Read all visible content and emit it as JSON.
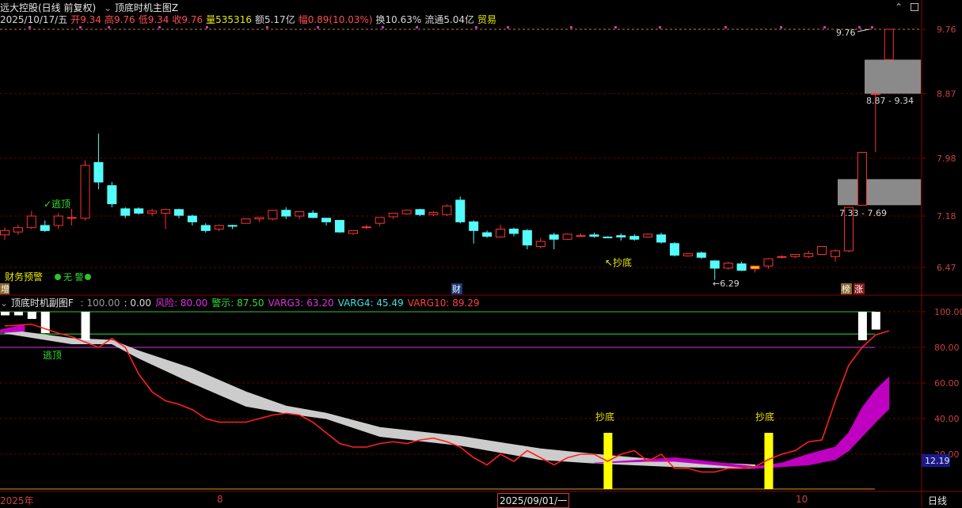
{
  "main_header": {
    "stock": "远大控股(日线 前复权)",
    "indicator": "顶底时机主图Z"
  },
  "info_bar": [
    {
      "text": "2025/10/17/五",
      "color": "#d8d8d8"
    },
    {
      "text": "开9.34",
      "color": "#ff4d4d"
    },
    {
      "text": "高9.76",
      "color": "#ff4d4d"
    },
    {
      "text": "低9.34",
      "color": "#ff4d4d"
    },
    {
      "text": "收9.76",
      "color": "#ff4d4d"
    },
    {
      "text": "量535316",
      "color": "#e8e800"
    },
    {
      "text": "额5.17亿",
      "color": "#d8d8d8"
    },
    {
      "text": "幅0.89(10.03%)",
      "color": "#ff4d4d"
    },
    {
      "text": "换10.63%",
      "color": "#d8d8d8"
    },
    {
      "text": "流通5.04亿",
      "color": "#d8d8d8"
    },
    {
      "text": "贸易",
      "color": "#e8e800"
    }
  ],
  "sub_header": {
    "name": "顶底时机副图F",
    "values": [
      {
        "text": ": 100.00",
        "color": "#9a9a9a"
      },
      {
        "text": ": 0.00",
        "color": "#d8d8d8"
      },
      {
        "text": "风险: 80.00",
        "color": "#e030e0"
      },
      {
        "text": "警示: 87.50",
        "color": "#30e030"
      },
      {
        "text": "VARG3: 63.20",
        "color": "#e030e0"
      },
      {
        "text": "VARG4: 45.49",
        "color": "#40e0e0"
      },
      {
        "text": "VARG10: 89.29",
        "color": "#ff4040"
      }
    ]
  },
  "labels": {
    "escape_top_main": "✓逃顶",
    "fin_warning": "财务预警",
    "fin_warning_none": "无 警",
    "bottom_buy_main": "↖抄底",
    "low_marker": "←6.29",
    "high_marker": "9.76",
    "zone_upper": "8.87 - 9.34",
    "zone_lower": "7.33 - 7.69",
    "badge_left": "增",
    "badge_cai": "财",
    "badge_bang": "榜",
    "badge_zhang": "涨",
    "escape_top_sub": "逃顶",
    "bottom_buy_sub_1": "抄底",
    "bottom_buy_sub_2": "抄底",
    "current_value_tag": "12.19"
  },
  "bottom_axis": {
    "labels": [
      "2025年",
      "8",
      "2025/09/01/一",
      "10"
    ],
    "period": "日线"
  },
  "colors": {
    "up": "#ff3232",
    "down": "#54fcfc",
    "grid": "#8b0000",
    "risk_line": "#e030e0",
    "warn_line": "#30e030",
    "varg3": "#c000c0",
    "varg4": "#cccccc",
    "varg10": "#ff2020",
    "bottom_bar": "#ffff00"
  },
  "chart_data": [
    {
      "type": "candlestick",
      "title": "远大控股(日线 前复权)",
      "y_ticks": [
        6.47,
        7.18,
        7.98,
        8.87,
        9.76
      ],
      "candles": [
        {
          "o": 6.92,
          "h": 7.02,
          "l": 6.85,
          "c": 6.98
        },
        {
          "o": 6.96,
          "h": 7.06,
          "l": 6.92,
          "c": 7.02
        },
        {
          "o": 7.02,
          "h": 7.25,
          "l": 7.0,
          "c": 7.18
        },
        {
          "o": 7.05,
          "h": 7.12,
          "l": 6.96,
          "c": 6.98
        },
        {
          "o": 7.05,
          "h": 7.22,
          "l": 7.0,
          "c": 7.18
        },
        {
          "o": 7.16,
          "h": 7.28,
          "l": 7.05,
          "c": 7.16
        },
        {
          "o": 7.15,
          "h": 7.95,
          "l": 7.12,
          "c": 7.88
        },
        {
          "o": 7.92,
          "h": 8.32,
          "l": 7.55,
          "c": 7.65
        },
        {
          "o": 7.6,
          "h": 7.65,
          "l": 7.3,
          "c": 7.35
        },
        {
          "o": 7.28,
          "h": 7.3,
          "l": 7.15,
          "c": 7.19
        },
        {
          "o": 7.28,
          "h": 7.3,
          "l": 7.2,
          "c": 7.22
        },
        {
          "o": 7.22,
          "h": 7.28,
          "l": 7.18,
          "c": 7.25
        },
        {
          "o": 7.22,
          "h": 7.28,
          "l": 7.0,
          "c": 7.27
        },
        {
          "o": 7.27,
          "h": 7.28,
          "l": 7.15,
          "c": 7.19
        },
        {
          "o": 7.18,
          "h": 7.2,
          "l": 7.05,
          "c": 7.1
        },
        {
          "o": 7.05,
          "h": 7.08,
          "l": 6.95,
          "c": 6.98
        },
        {
          "o": 7.0,
          "h": 7.06,
          "l": 6.97,
          "c": 7.05
        },
        {
          "o": 7.05,
          "h": 7.06,
          "l": 7.0,
          "c": 7.04
        },
        {
          "o": 7.08,
          "h": 7.14,
          "l": 7.08,
          "c": 7.14
        },
        {
          "o": 7.14,
          "h": 7.16,
          "l": 7.1,
          "c": 7.16
        },
        {
          "o": 7.14,
          "h": 7.26,
          "l": 7.12,
          "c": 7.26
        },
        {
          "o": 7.26,
          "h": 7.3,
          "l": 7.14,
          "c": 7.18
        },
        {
          "o": 7.18,
          "h": 7.24,
          "l": 7.14,
          "c": 7.24
        },
        {
          "o": 7.22,
          "h": 7.26,
          "l": 7.15,
          "c": 7.16
        },
        {
          "o": 7.15,
          "h": 7.15,
          "l": 7.05,
          "c": 7.1
        },
        {
          "o": 7.12,
          "h": 7.12,
          "l": 6.95,
          "c": 6.96
        },
        {
          "o": 6.94,
          "h": 6.98,
          "l": 6.92,
          "c": 6.98
        },
        {
          "o": 7.02,
          "h": 7.06,
          "l": 7.0,
          "c": 7.03
        },
        {
          "o": 7.08,
          "h": 7.16,
          "l": 7.04,
          "c": 7.16
        },
        {
          "o": 7.17,
          "h": 7.22,
          "l": 7.14,
          "c": 7.22
        },
        {
          "o": 7.21,
          "h": 7.27,
          "l": 7.2,
          "c": 7.26
        },
        {
          "o": 7.27,
          "h": 7.28,
          "l": 7.18,
          "c": 7.2
        },
        {
          "o": 7.2,
          "h": 7.25,
          "l": 7.18,
          "c": 7.23
        },
        {
          "o": 7.2,
          "h": 7.34,
          "l": 7.18,
          "c": 7.32
        },
        {
          "o": 7.4,
          "h": 7.45,
          "l": 7.08,
          "c": 7.1
        },
        {
          "o": 7.1,
          "h": 7.12,
          "l": 6.8,
          "c": 6.98
        },
        {
          "o": 6.95,
          "h": 6.98,
          "l": 6.88,
          "c": 6.9
        },
        {
          "o": 6.89,
          "h": 7.06,
          "l": 6.88,
          "c": 7.0
        },
        {
          "o": 7.0,
          "h": 7.02,
          "l": 6.9,
          "c": 6.94
        },
        {
          "o": 6.98,
          "h": 7.0,
          "l": 6.72,
          "c": 6.78
        },
        {
          "o": 6.76,
          "h": 6.88,
          "l": 6.73,
          "c": 6.83
        },
        {
          "o": 6.92,
          "h": 6.95,
          "l": 6.72,
          "c": 6.86
        },
        {
          "o": 6.86,
          "h": 6.94,
          "l": 6.85,
          "c": 6.93
        },
        {
          "o": 6.9,
          "h": 6.94,
          "l": 6.9,
          "c": 6.91
        },
        {
          "o": 6.92,
          "h": 6.95,
          "l": 6.88,
          "c": 6.9
        },
        {
          "o": 6.89,
          "h": 6.9,
          "l": 6.88,
          "c": 6.88
        },
        {
          "o": 6.91,
          "h": 6.94,
          "l": 6.84,
          "c": 6.89
        },
        {
          "o": 6.9,
          "h": 6.93,
          "l": 6.84,
          "c": 6.86
        },
        {
          "o": 6.89,
          "h": 6.94,
          "l": 6.88,
          "c": 6.93
        },
        {
          "o": 6.92,
          "h": 6.95,
          "l": 6.8,
          "c": 6.82
        },
        {
          "o": 6.8,
          "h": 6.82,
          "l": 6.62,
          "c": 6.64
        },
        {
          "o": 6.63,
          "h": 6.67,
          "l": 6.62,
          "c": 6.66
        },
        {
          "o": 6.67,
          "h": 6.69,
          "l": 6.59,
          "c": 6.61
        },
        {
          "o": 6.56,
          "h": 6.57,
          "l": 6.3,
          "c": 6.46
        },
        {
          "o": 6.46,
          "h": 6.55,
          "l": 6.44,
          "c": 6.53
        },
        {
          "o": 6.52,
          "h": 6.55,
          "l": 6.42,
          "c": 6.43
        },
        {
          "o": 6.45,
          "h": 6.49,
          "l": 6.4,
          "c": 6.49
        },
        {
          "o": 6.49,
          "h": 6.6,
          "l": 6.45,
          "c": 6.59
        },
        {
          "o": 6.61,
          "h": 6.64,
          "l": 6.59,
          "c": 6.62
        },
        {
          "o": 6.62,
          "h": 6.65,
          "l": 6.6,
          "c": 6.65
        },
        {
          "o": 6.62,
          "h": 6.7,
          "l": 6.6,
          "c": 6.66
        },
        {
          "o": 6.65,
          "h": 6.76,
          "l": 6.64,
          "c": 6.76
        },
        {
          "o": 6.62,
          "h": 6.72,
          "l": 6.55,
          "c": 6.7
        },
        {
          "o": 6.7,
          "h": 7.3,
          "l": 6.68,
          "c": 7.3
        },
        {
          "o": 7.33,
          "h": 8.06,
          "l": 7.33,
          "c": 8.06
        },
        {
          "o": 8.87,
          "h": 8.87,
          "l": 8.06,
          "c": 8.87
        },
        {
          "o": 9.34,
          "h": 9.76,
          "l": 9.34,
          "c": 9.76
        }
      ],
      "highlighted_candle": 56,
      "zones": [
        {
          "from": 8.87,
          "to": 9.34
        },
        {
          "from": 7.33,
          "to": 7.69
        }
      ]
    },
    {
      "type": "line",
      "title": "顶底时机副图F",
      "y_ticks": [
        20,
        40,
        60,
        80,
        100
      ],
      "ylim": [
        3,
        105
      ],
      "reference_lines": {
        "top": 100,
        "risk": 80,
        "warn": 87.5,
        "bottom": 0
      },
      "varg10_points": [
        [
          0,
          92
        ],
        [
          2,
          93
        ],
        [
          4,
          88
        ],
        [
          5,
          86
        ],
        [
          7,
          80
        ],
        [
          8,
          85
        ],
        [
          9,
          80
        ],
        [
          10,
          65
        ],
        [
          11,
          55
        ],
        [
          12,
          50
        ],
        [
          13,
          48
        ],
        [
          14,
          45
        ],
        [
          15,
          40
        ],
        [
          16,
          38
        ],
        [
          17,
          38
        ],
        [
          18,
          38
        ],
        [
          19,
          40
        ],
        [
          20,
          42
        ],
        [
          21,
          43
        ],
        [
          22,
          42
        ],
        [
          23,
          38
        ],
        [
          24,
          32
        ],
        [
          25,
          26
        ],
        [
          26,
          24
        ],
        [
          27,
          24
        ],
        [
          28,
          26
        ],
        [
          29,
          27
        ],
        [
          30,
          26
        ],
        [
          31,
          28
        ],
        [
          32,
          29
        ],
        [
          33,
          27
        ],
        [
          34,
          24
        ],
        [
          35,
          18
        ],
        [
          36,
          14
        ],
        [
          37,
          20
        ],
        [
          38,
          16
        ],
        [
          39,
          22
        ],
        [
          40,
          18
        ],
        [
          41,
          14
        ],
        [
          42,
          18
        ],
        [
          43,
          20
        ],
        [
          44,
          20
        ],
        [
          45,
          16
        ],
        [
          46,
          20
        ],
        [
          47,
          22
        ],
        [
          48,
          16
        ],
        [
          49,
          20
        ],
        [
          50,
          12
        ],
        [
          51,
          12
        ],
        [
          52,
          10
        ],
        [
          53,
          10
        ],
        [
          54,
          12
        ],
        [
          55,
          12
        ],
        [
          56,
          13
        ],
        [
          57,
          17
        ],
        [
          58,
          20
        ],
        [
          59,
          22
        ],
        [
          60,
          27
        ],
        [
          61,
          28
        ],
        [
          62,
          50
        ],
        [
          63,
          70
        ],
        [
          64,
          80
        ],
        [
          65,
          87
        ],
        [
          66,
          89.29
        ]
      ],
      "varg4_band": [
        {
          "x": 0,
          "upper": 88,
          "lower": 90
        },
        {
          "x": 5,
          "upper": 82,
          "lower": 85
        },
        {
          "x": 8,
          "upper": 82,
          "lower": 84
        },
        {
          "x": 10,
          "upper": 74,
          "lower": 78
        },
        {
          "x": 14,
          "upper": 60,
          "lower": 68
        },
        {
          "x": 18,
          "upper": 47,
          "lower": 55
        },
        {
          "x": 21,
          "upper": 43,
          "lower": 47
        },
        {
          "x": 24,
          "upper": 40,
          "lower": 43
        },
        {
          "x": 28,
          "upper": 30,
          "lower": 35
        },
        {
          "x": 34,
          "upper": 25,
          "lower": 30
        },
        {
          "x": 40,
          "upper": 17,
          "lower": 23
        },
        {
          "x": 44,
          "upper": 15,
          "lower": 20
        },
        {
          "x": 50,
          "upper": 13,
          "lower": 16
        },
        {
          "x": 56,
          "upper": 12,
          "lower": 14
        }
      ],
      "varg3_band": [
        {
          "x": 44,
          "upper": 15,
          "lower": 15
        },
        {
          "x": 48,
          "upper": 17,
          "lower": 16
        },
        {
          "x": 50,
          "upper": 18,
          "lower": 16
        },
        {
          "x": 56,
          "upper": 13,
          "lower": 12
        },
        {
          "x": 58,
          "upper": 15,
          "lower": 13
        },
        {
          "x": 60,
          "upper": 20,
          "lower": 14
        },
        {
          "x": 62,
          "upper": 24,
          "lower": 17
        },
        {
          "x": 63,
          "upper": 32,
          "lower": 22
        },
        {
          "x": 64,
          "upper": 46,
          "lower": 30
        },
        {
          "x": 65,
          "upper": 56,
          "lower": 38
        },
        {
          "x": 66,
          "upper": 63.2,
          "lower": 45.49
        }
      ],
      "current_value": 12.19
    }
  ]
}
